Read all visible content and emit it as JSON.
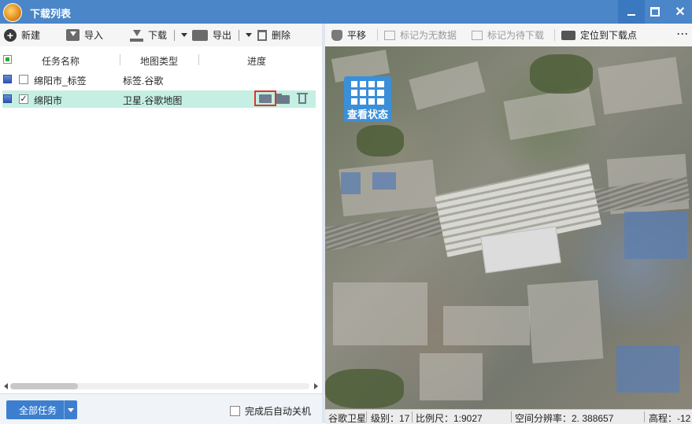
{
  "window": {
    "title": "下载列表"
  },
  "left_toolbar": {
    "new_label": "新建",
    "import_label": "导入",
    "download_label": "下载",
    "export_label": "导出",
    "delete_label": "删除"
  },
  "right_toolbar": {
    "pan_label": "平移",
    "mark_nodata_label": "标记为无数据",
    "mark_pending_label": "标记为待下载",
    "locate_label": "定位到下载点",
    "more_label": "···"
  },
  "task_table": {
    "columns": [
      "任务名称",
      "地图类型",
      "进度"
    ],
    "rows": [
      {
        "name": "绵阳市_标签",
        "type": "标签.谷歌",
        "checked": false,
        "selected": false
      },
      {
        "name": "绵阳市",
        "type": "卫星.谷歌地图",
        "checked": true,
        "selected": true
      }
    ]
  },
  "bottom": {
    "all_tasks_label": "全部任务",
    "auto_shutdown_label": "完成后自动关机"
  },
  "map": {
    "status_button_label": "查看状态",
    "status_bar": {
      "source": "谷歌卫星",
      "level": "级别：17",
      "scale": "比例尺：1:9027",
      "resolution": "空间分辨率：2. 388657",
      "elevation": "高程：-12"
    }
  },
  "colors": {
    "title_bar": "#4a86c8",
    "selected_row": "#c4efe2",
    "highlight_box": "#e0332d",
    "accent_button": "#3d7fce"
  }
}
